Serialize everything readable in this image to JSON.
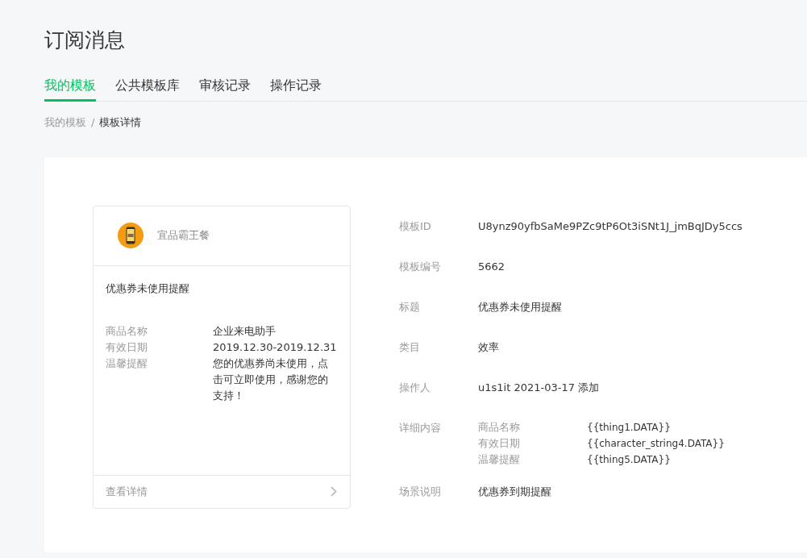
{
  "page_title": "订阅消息",
  "tabs": [
    {
      "label": "我的模板",
      "selected": true
    },
    {
      "label": "公共模板库",
      "selected": false
    },
    {
      "label": "审核记录",
      "selected": false
    },
    {
      "label": "操作记录",
      "selected": false
    }
  ],
  "breadcrumb": {
    "items": [
      "我的模板",
      "模板详情"
    ],
    "separator": "/"
  },
  "preview": {
    "account_name": "宜品霸王餐",
    "title": "优惠券未使用提醒",
    "fields": [
      {
        "label": "商品名称",
        "value": "企业来电助手"
      },
      {
        "label": "有效日期",
        "value": "2019.12.30-2019.12.31"
      },
      {
        "label": "温馨提醒",
        "value": "您的优惠券尚未使用，点击可立即使用，感谢您的支持！"
      }
    ],
    "footer_link": "查看详情"
  },
  "details": [
    {
      "kind": "text",
      "label": "模板ID",
      "value": "U8ynz90yfbSaMe9PZc9tP6Ot3iSNt1J_jmBqJDy5ccs"
    },
    {
      "kind": "text",
      "label": "模板编号",
      "value": "5662"
    },
    {
      "kind": "text",
      "label": "标题",
      "value": "优惠券未使用提醒"
    },
    {
      "kind": "text",
      "label": "类目",
      "value": "效率"
    },
    {
      "kind": "text",
      "label": "操作人",
      "value": "u1s1it 2021-03-17 添加"
    },
    {
      "kind": "fields",
      "label": "详细内容",
      "items": [
        {
          "label": "商品名称",
          "value": "{{thing1.DATA}}"
        },
        {
          "label": "有效日期",
          "value": "{{character_string4.DATA}}"
        },
        {
          "label": "温馨提醒",
          "value": "{{thing5.DATA}}"
        }
      ]
    },
    {
      "kind": "text",
      "label": "场景说明",
      "value": "优惠券到期提醒"
    }
  ]
}
